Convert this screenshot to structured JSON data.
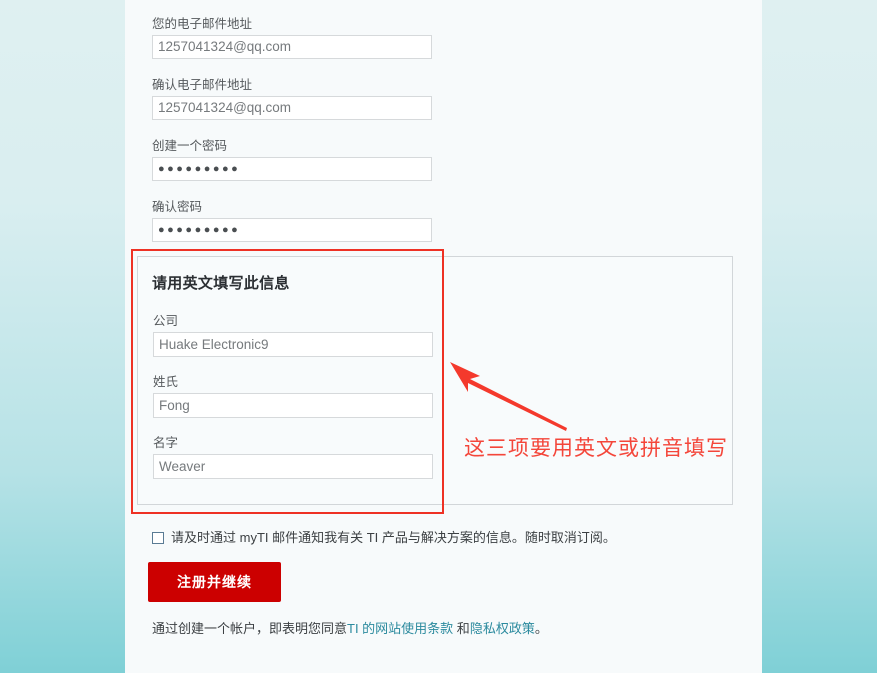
{
  "page": {
    "background_top_color": "#dff0f1",
    "background_bottom_color": "#7fd0d6",
    "panel_background": "#f7fafb"
  },
  "form": {
    "fields": [
      {
        "label": "您的电子邮件地址",
        "value": "1257041324@qq.com",
        "type": "email"
      },
      {
        "label": "确认电子邮件地址",
        "value": "1257041324@qq.com",
        "type": "email"
      },
      {
        "label": "创建一个密码",
        "value": "●●●●●●●●●",
        "type": "password"
      },
      {
        "label": "确认密码",
        "value": "●●●●●●●●●",
        "type": "password"
      }
    ]
  },
  "english_panel": {
    "heading": "请用英文填写此信息",
    "fields": [
      {
        "label": "公司",
        "value": "Huake Electronic9"
      },
      {
        "label": "姓氏",
        "value": "Fong"
      },
      {
        "label": "名字",
        "value": "Weaver"
      }
    ]
  },
  "annotation": {
    "text": "这三项要用英文或拼音填写",
    "color": "#f4463a",
    "box_color": "#ee3124",
    "arrow_name": "red-arrow-pointing-to-english-fields"
  },
  "newsletter": {
    "checked": false,
    "label": "请及时通过 myTI 邮件通知我有关 TI 产品与解决方案的信息。随时取消订阅。"
  },
  "submit": {
    "label": "注册并继续",
    "color": "#cc0000"
  },
  "legal": {
    "prefix": "通过创建一个帐户，即表明您同意",
    "link1": "TI 的网站使用条款",
    "middle": " 和",
    "link2": "隐私权政策",
    "suffix": "。",
    "link_color": "#2b8a9e"
  }
}
